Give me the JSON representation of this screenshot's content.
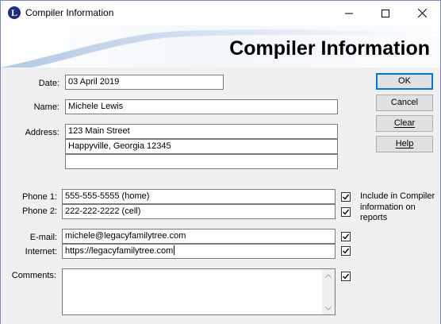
{
  "window": {
    "title": "Compiler Information",
    "icon_letter": "L"
  },
  "banner": {
    "title": "Compiler Information"
  },
  "form": {
    "date_label": "Date:",
    "date_value": "03 April 2019",
    "name_label": "Name:",
    "name_value": "Michele Lewis",
    "address_label": "Address:",
    "address_lines": [
      "123 Main Street",
      "Happyville, Georgia 12345",
      ""
    ],
    "phone1_label": "Phone 1:",
    "phone1_value": "555-555-5555 (home)",
    "phone2_label": "Phone 2:",
    "phone2_value": "222-222-2222 (cell)",
    "email_label": "E-mail:",
    "email_value": "michele@legacyfamilytree.com",
    "internet_label": "Internet:",
    "internet_value": "https://legacyfamilytree.com",
    "comments_label": "Comments:",
    "comments_value": "",
    "include_note": "Include in Compiler information on reports"
  },
  "checkboxes": {
    "address_include": true,
    "phone_include": true,
    "email_include": true,
    "internet_include": true,
    "comments_include": true
  },
  "buttons": {
    "ok": "OK",
    "cancel": "Cancel",
    "clear": "Clear",
    "help": "Help"
  },
  "colors": {
    "banner_accent": "#1e63b8",
    "window_border": "#7a86c6",
    "default_button_border": "#0078d7"
  }
}
